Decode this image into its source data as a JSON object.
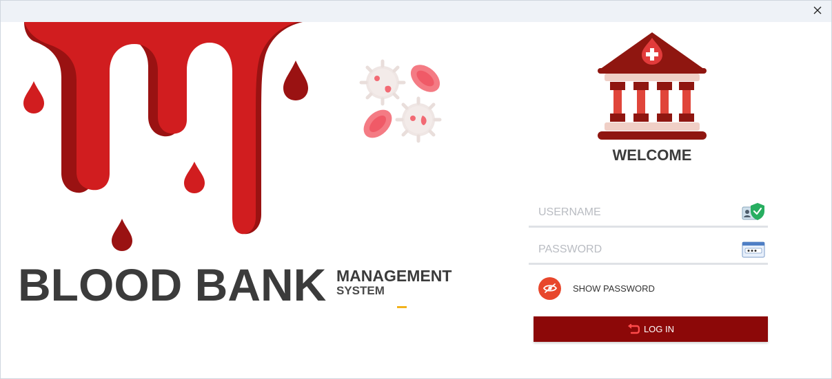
{
  "window": {
    "close_glyph": "✕"
  },
  "branding": {
    "title_big": "BLOOD BANK",
    "title_small_1": "MANAGEMENT",
    "title_small_2": "SYSTEM"
  },
  "login": {
    "welcome": "WELCOME",
    "username_placeholder": "USERNAME",
    "username_value": "",
    "password_placeholder": "PASSWORD",
    "password_value": "",
    "show_password_label": "SHOW PASSWORD",
    "login_button_label": "LOG IN"
  },
  "icons": {
    "close": "close-icon",
    "bank_logo": "blood-bank-building-icon",
    "username": "user-id-card-shield-icon",
    "password": "password-field-icon",
    "show_password": "eye-off-icon",
    "login": "login-arrow-icon"
  },
  "colors": {
    "blood_red": "#c8181b",
    "blood_dark": "#8e1010",
    "login_button": "#8c0808",
    "eye_toggle": "#e8472c",
    "text_dark": "#3b3b3b",
    "accent_dash": "#f2b21c"
  }
}
